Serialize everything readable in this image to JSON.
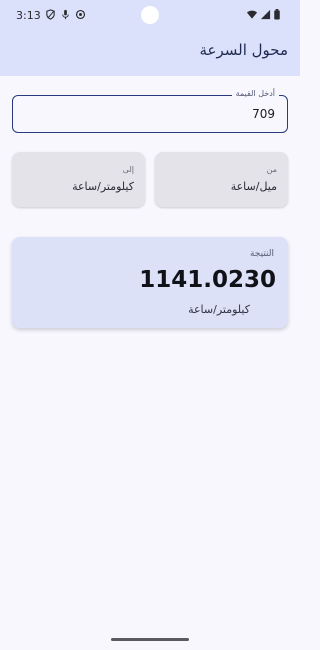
{
  "status_bar": {
    "time": "3:13",
    "left_icons": [
      "shield-icon",
      "mic-icon",
      "sync-icon"
    ],
    "right_icons": [
      "wifi-icon",
      "signal-icon",
      "battery-icon"
    ]
  },
  "app": {
    "title": "محول السرعة"
  },
  "input": {
    "label": "أدخل القيمة",
    "value": "709"
  },
  "from_unit": {
    "label": "من",
    "value": "ميل/ساعة"
  },
  "to_unit": {
    "label": "إلى",
    "value": "كيلومتر/ساعة"
  },
  "result": {
    "label": "النتيجة",
    "value": "1141.0230",
    "unit": "كيلومتر/ساعة"
  },
  "colors": {
    "app_bar": "#dbe1fb",
    "background": "#f8f7fe",
    "input_border": "#2a3a80",
    "unit_card": "#e4e3ea",
    "result_card": "#dde1f8"
  }
}
